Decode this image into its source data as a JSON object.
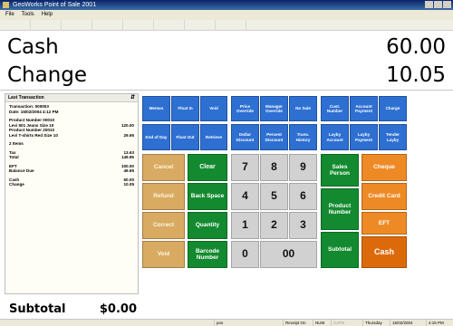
{
  "window": {
    "title": "GeoWorks Point of Sale 2001"
  },
  "menu": [
    "File",
    "Tools",
    "Help"
  ],
  "display": {
    "tender_label": "Cash",
    "tender_value": "60.00",
    "change_label": "Change",
    "change_value": "10.05"
  },
  "last_transaction": {
    "header": "Last Transaction",
    "pin": "⇵",
    "lines": [
      {
        "label": "Transaction: 000003",
        "value": ""
      },
      {
        "label": "Date: 15/02/2004 4:12 PM",
        "value": ""
      },
      {
        "label": "",
        "value": ""
      },
      {
        "label": "Product Number 00010",
        "value": ""
      },
      {
        "label": "Levi 501 Jeans Size 10",
        "value": "120.00"
      },
      {
        "label": "Product Number 20010",
        "value": ""
      },
      {
        "label": "Levi T-shirts Red Size 10",
        "value": "29.95"
      },
      {
        "label": "",
        "value": ""
      },
      {
        "label": "2 Items",
        "value": ""
      },
      {
        "label": "",
        "value": ""
      },
      {
        "label": "Tax",
        "value": "13.63"
      },
      {
        "label": "Total",
        "value": "149.95"
      },
      {
        "label": "",
        "value": ""
      },
      {
        "label": "EFT",
        "value": "100.00"
      },
      {
        "label": "Balance Due",
        "value": "49.95"
      },
      {
        "label": "",
        "value": ""
      },
      {
        "label": "Cash",
        "value": "60.00"
      },
      {
        "label": "Change",
        "value": "10.05"
      }
    ]
  },
  "subtotal": {
    "label": "Subtotal",
    "value": "$0.00"
  },
  "buttons": {
    "memos": "Memos",
    "float_in": "Float In",
    "void_top": "Void",
    "price_override": "Price Override",
    "manager_override": "Manager Override",
    "no_sale": "No Sale",
    "cust_number": "Cust. Number",
    "account_payment": "Account Payment",
    "charge": "Charge",
    "end_of_day": "End of Day",
    "float_out": "Float Out",
    "retrieve": "Retrieve",
    "dollar_discount": "Dollar Discount",
    "percent_discount": "Percent Discount",
    "trans_history": "Trans. History",
    "layby_account": "Layby Account",
    "layby_payment": "Layby Payment",
    "tender_layby": "Tender Layby",
    "cancel": "Cancel",
    "refund": "Refund",
    "correct": "Correct",
    "void": "Void",
    "clear": "Clear",
    "back_space": "Back Space",
    "quantity": "Quantity",
    "barcode_number": "Barcode Number",
    "k7": "7",
    "k8": "8",
    "k9": "9",
    "k4": "4",
    "k5": "5",
    "k6": "6",
    "k1": "1",
    "k2": "2",
    "k3": "3",
    "k0": "0",
    "k00": "00",
    "sales_person": "Sales Person",
    "product_number": "Product Number",
    "subtotal_btn": "Subtotal",
    "cheque": "Cheque",
    "credit_card": "Credit Card",
    "eft": "EFT",
    "cash": "Cash"
  },
  "statusbar": {
    "user": "pos",
    "receipt": "Receipt On",
    "num": "NUM",
    "caps": "CAPS",
    "day": "Thursday",
    "date": "15/02/2004",
    "time": "4:15 PM"
  },
  "colors": {
    "function_blue": "#2e6fd2",
    "tan": "#d8aa62",
    "green": "#138a2f",
    "numpad_gray": "#d1d1d1",
    "tender_orange": "#ee8a25",
    "cash_orange": "#dd6a0a"
  }
}
